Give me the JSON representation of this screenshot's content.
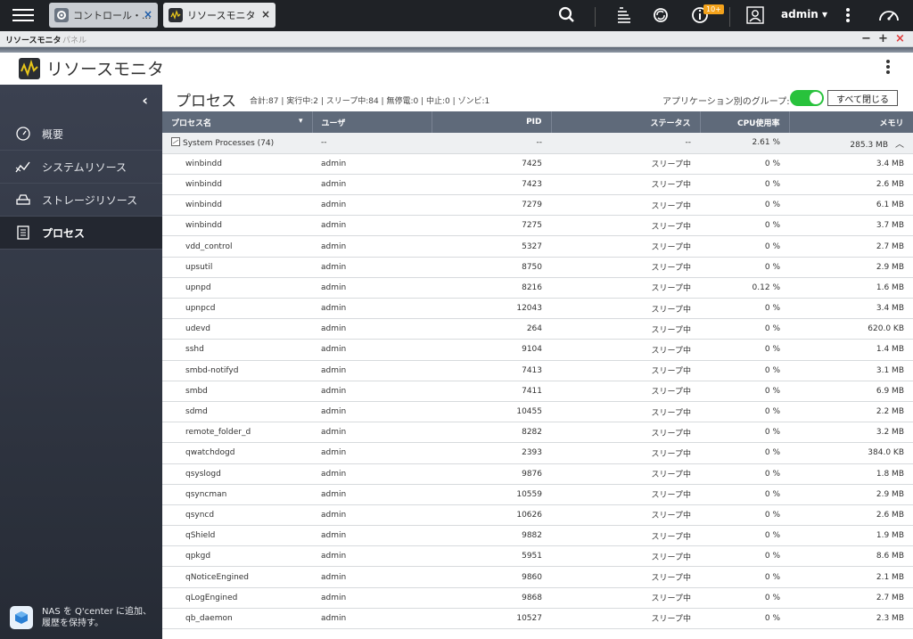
{
  "topbar": {
    "tabs": [
      {
        "label": "コントロール・...",
        "close": "×"
      },
      {
        "label": "リソースモニタ",
        "close": "×"
      }
    ],
    "notification_badge": "10+",
    "user": "admin",
    "user_caret": "▾"
  },
  "panel": {
    "title": "リソースモニタ",
    "ghost_title": "パネル",
    "controls": {
      "minimize": "−",
      "maximize": "+",
      "close": "×"
    }
  },
  "app": {
    "title": "リソースモニタ"
  },
  "sidebar": {
    "collapse": "‹",
    "items": [
      {
        "label": "概要",
        "icon": "gauge-icon"
      },
      {
        "label": "システムリソース",
        "icon": "chart-line-icon"
      },
      {
        "label": "ストレージリソース",
        "icon": "drive-icon"
      },
      {
        "label": "プロセス",
        "icon": "document-list-icon",
        "active": true
      }
    ],
    "qcenter": {
      "line1": "NAS を Q'center に追加、",
      "line2": "履歴を保持す。"
    }
  },
  "main": {
    "title": "プロセス",
    "summary": "合計:87 | 実行中:2 | スリープ中:84 | 無停電:0 | 中止:0 | ゾンビ:1",
    "group_label": "アプリケーション別のグループ:",
    "group_toggle_on": true,
    "close_all": "すべて閉じる",
    "columns": [
      "プロセス名",
      "ユーザ",
      "PID",
      "ステータス",
      "CPU使用率",
      "メモリ"
    ],
    "sort_arrow": "▾",
    "group_row": {
      "name": "System Processes (74)",
      "user": "--",
      "pid": "--",
      "status": "--",
      "cpu": "2.61 %",
      "mem": "285.3 MB",
      "caret": "︿"
    },
    "rows": [
      {
        "name": "winbindd",
        "user": "admin",
        "pid": "7425",
        "status": "スリープ中",
        "cpu": "0 %",
        "mem": "3.4 MB"
      },
      {
        "name": "winbindd",
        "user": "admin",
        "pid": "7423",
        "status": "スリープ中",
        "cpu": "0 %",
        "mem": "2.6 MB"
      },
      {
        "name": "winbindd",
        "user": "admin",
        "pid": "7279",
        "status": "スリープ中",
        "cpu": "0 %",
        "mem": "6.1 MB"
      },
      {
        "name": "winbindd",
        "user": "admin",
        "pid": "7275",
        "status": "スリープ中",
        "cpu": "0 %",
        "mem": "3.7 MB"
      },
      {
        "name": "vdd_control",
        "user": "admin",
        "pid": "5327",
        "status": "スリープ中",
        "cpu": "0 %",
        "mem": "2.7 MB"
      },
      {
        "name": "upsutil",
        "user": "admin",
        "pid": "8750",
        "status": "スリープ中",
        "cpu": "0 %",
        "mem": "2.9 MB"
      },
      {
        "name": "upnpd",
        "user": "admin",
        "pid": "8216",
        "status": "スリープ中",
        "cpu": "0.12 %",
        "mem": "1.6 MB"
      },
      {
        "name": "upnpcd",
        "user": "admin",
        "pid": "12043",
        "status": "スリープ中",
        "cpu": "0 %",
        "mem": "3.4 MB"
      },
      {
        "name": "udevd",
        "user": "admin",
        "pid": "264",
        "status": "スリープ中",
        "cpu": "0 %",
        "mem": "620.0 KB"
      },
      {
        "name": "sshd",
        "user": "admin",
        "pid": "9104",
        "status": "スリープ中",
        "cpu": "0 %",
        "mem": "1.4 MB"
      },
      {
        "name": "smbd-notifyd",
        "user": "admin",
        "pid": "7413",
        "status": "スリープ中",
        "cpu": "0 %",
        "mem": "3.1 MB"
      },
      {
        "name": "smbd",
        "user": "admin",
        "pid": "7411",
        "status": "スリープ中",
        "cpu": "0 %",
        "mem": "6.9 MB"
      },
      {
        "name": "sdmd",
        "user": "admin",
        "pid": "10455",
        "status": "スリープ中",
        "cpu": "0 %",
        "mem": "2.2 MB"
      },
      {
        "name": "remote_folder_d",
        "user": "admin",
        "pid": "8282",
        "status": "スリープ中",
        "cpu": "0 %",
        "mem": "3.2 MB"
      },
      {
        "name": "qwatchdogd",
        "user": "admin",
        "pid": "2393",
        "status": "スリープ中",
        "cpu": "0 %",
        "mem": "384.0 KB"
      },
      {
        "name": "qsyslogd",
        "user": "admin",
        "pid": "9876",
        "status": "スリープ中",
        "cpu": "0 %",
        "mem": "1.8 MB"
      },
      {
        "name": "qsyncman",
        "user": "admin",
        "pid": "10559",
        "status": "スリープ中",
        "cpu": "0 %",
        "mem": "2.9 MB"
      },
      {
        "name": "qsyncd",
        "user": "admin",
        "pid": "10626",
        "status": "スリープ中",
        "cpu": "0 %",
        "mem": "2.6 MB"
      },
      {
        "name": "qShield",
        "user": "admin",
        "pid": "9882",
        "status": "スリープ中",
        "cpu": "0 %",
        "mem": "1.9 MB"
      },
      {
        "name": "qpkgd",
        "user": "admin",
        "pid": "5951",
        "status": "スリープ中",
        "cpu": "0 %",
        "mem": "8.6 MB"
      },
      {
        "name": "qNoticeEngined",
        "user": "admin",
        "pid": "9860",
        "status": "スリープ中",
        "cpu": "0 %",
        "mem": "2.1 MB"
      },
      {
        "name": "qLogEngined",
        "user": "admin",
        "pid": "9868",
        "status": "スリープ中",
        "cpu": "0 %",
        "mem": "2.7 MB"
      },
      {
        "name": "qb_daemon",
        "user": "admin",
        "pid": "10527",
        "status": "スリープ中",
        "cpu": "0 %",
        "mem": "2.3 MB"
      }
    ]
  },
  "colors": {
    "accent_toggle": "#28c23c",
    "header_row": "#5f6a7a",
    "close_red": "#e03a3a",
    "sidebar": "#343a47"
  }
}
